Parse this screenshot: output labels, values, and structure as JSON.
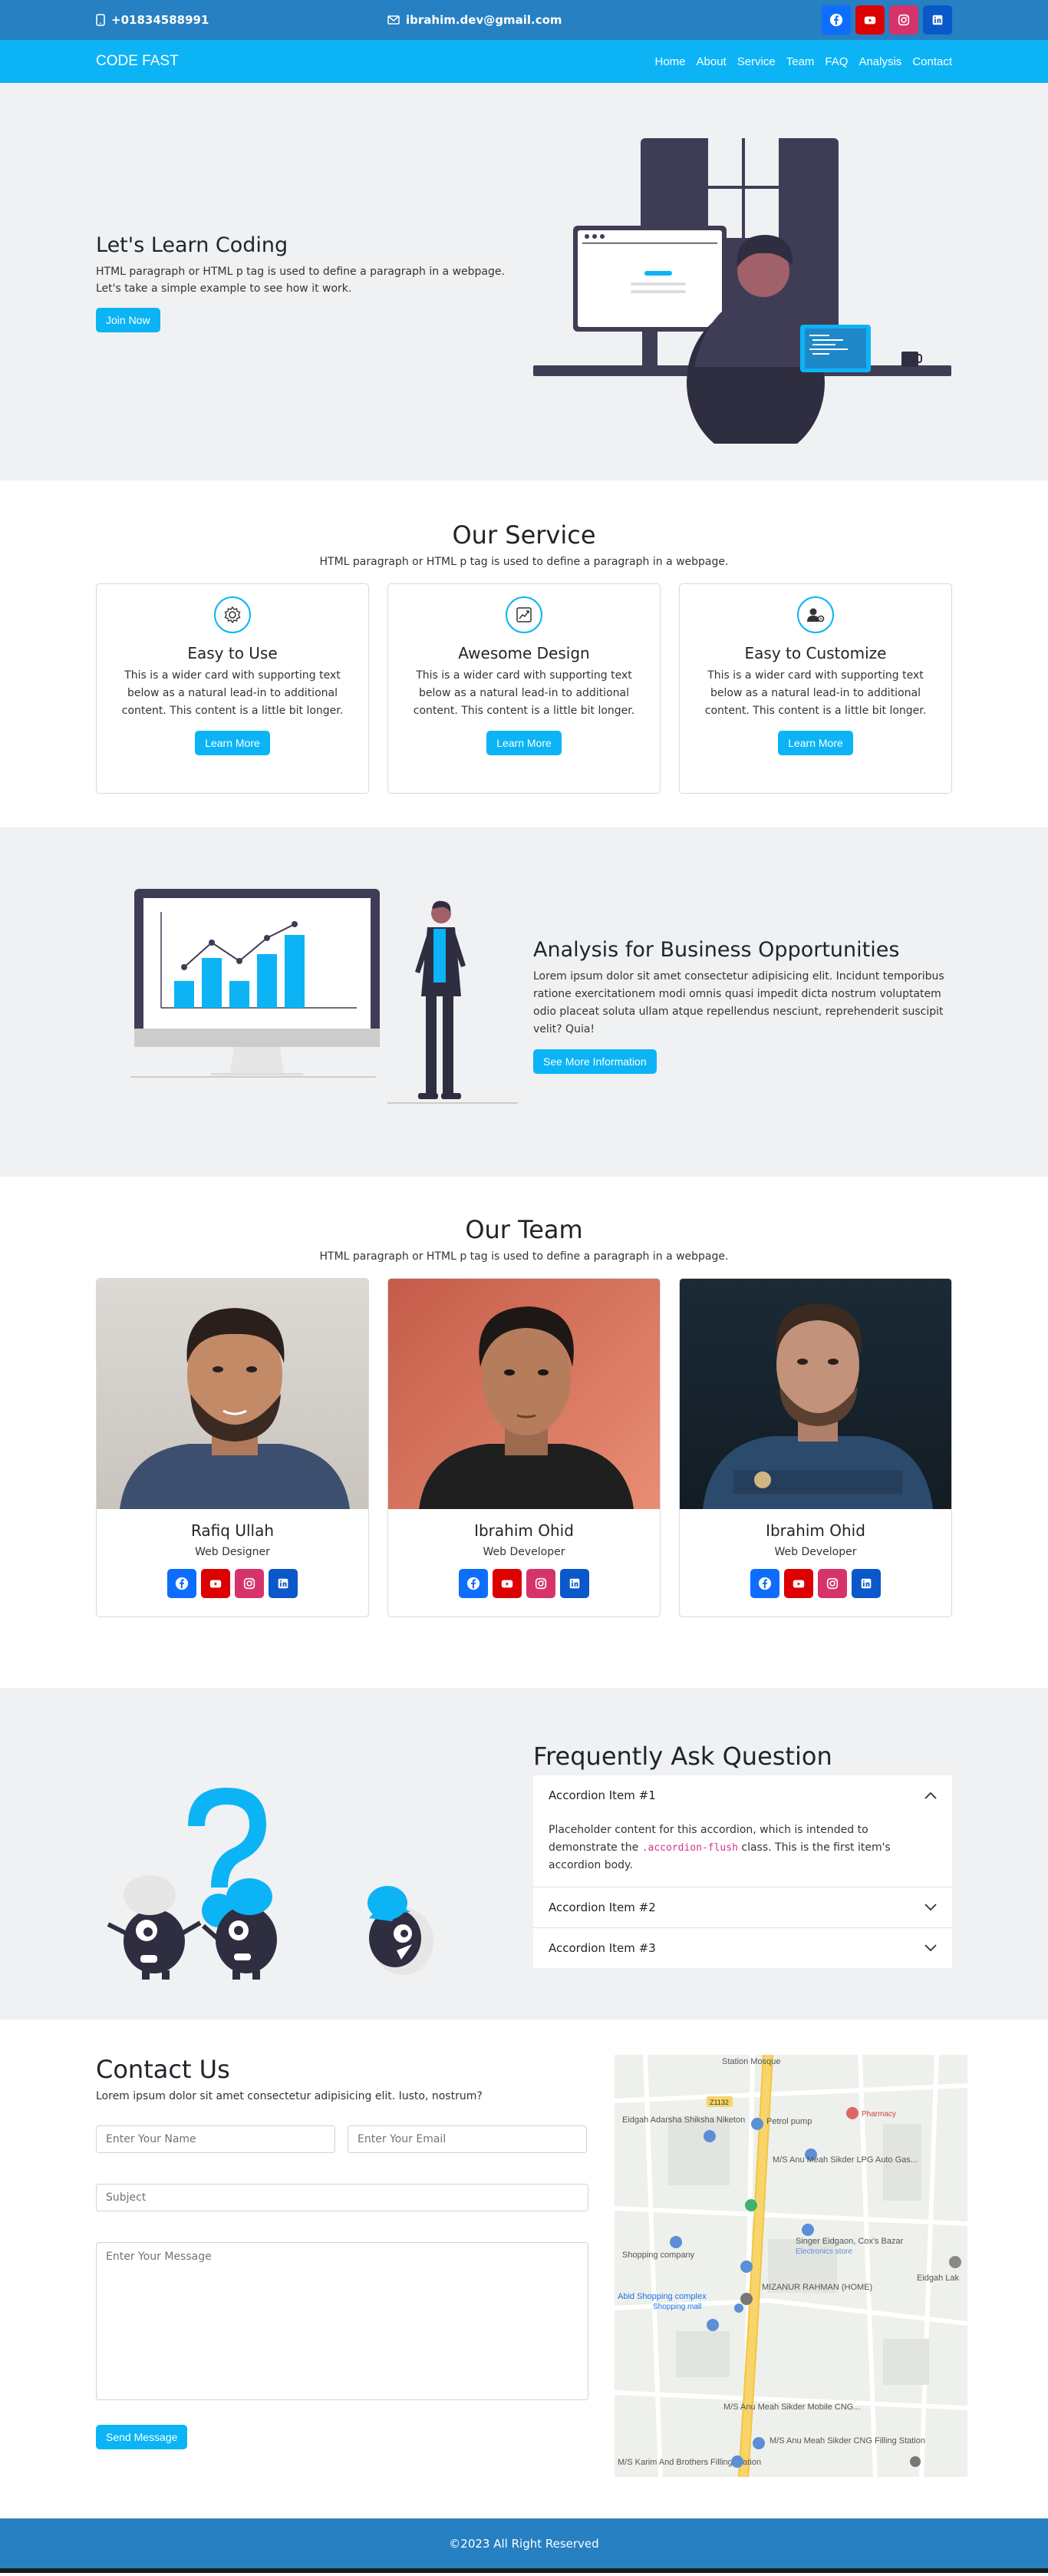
{
  "topbar": {
    "phone": "+01834588991",
    "email": "ibrahim.dev@gmail.com",
    "social": [
      "facebook-icon",
      "youtube-icon",
      "instagram-icon",
      "linkedin-icon"
    ]
  },
  "nav": {
    "brand": "CODE FAST",
    "links": [
      "Home",
      "About",
      "Service",
      "Team",
      "FAQ",
      "Analysis",
      "Contact"
    ]
  },
  "hero": {
    "title": "Let's Learn Coding",
    "text": "HTML paragraph or HTML p tag is used to define a paragraph in a webpage. Let's take a simple example to see how it work.",
    "button": "Join Now"
  },
  "service": {
    "title": "Our Service",
    "subtitle": "HTML paragraph or HTML p tag is used to define a paragraph in a webpage.",
    "cards": [
      {
        "icon": "gear-icon",
        "title": "Easy to Use",
        "text": "This is a wider card with supporting text below as a natural lead-in to additional content. This content is a little bit longer.",
        "button": "Learn More"
      },
      {
        "icon": "chart-line-icon",
        "title": "Awesome Design",
        "text": "This is a wider card with supporting text below as a natural lead-in to additional content. This content is a little bit longer.",
        "button": "Learn More"
      },
      {
        "icon": "user-gear-icon",
        "title": "Easy to Customize",
        "text": "This is a wider card with supporting text below as a natural lead-in to additional content. This content is a little bit longer.",
        "button": "Learn More"
      }
    ]
  },
  "analysis": {
    "title": "Analysis for Business Opportunities",
    "text": "Lorem ipsum dolor sit amet consectetur adipisicing elit. Incidunt temporibus ratione exercitationem modi omnis quasi impedit dicta nostrum voluptatem odio placeat soluta ullam atque repellendus nesciunt, reprehenderit suscipit velit? Quia!",
    "button": "See More Information"
  },
  "team": {
    "title": "Our Team",
    "subtitle": "HTML paragraph or HTML p tag is used to define a paragraph in a webpage.",
    "members": [
      {
        "name": "Rafiq Ullah",
        "role": "Web Designer"
      },
      {
        "name": "Ibrahim Ohid",
        "role": "Web Developer"
      },
      {
        "name": "Ibrahim Ohid",
        "role": "Web Developer"
      }
    ]
  },
  "faq": {
    "title": "Frequently Ask Question",
    "items": [
      {
        "label": "Accordion Item #1",
        "open": true,
        "body_before": "Placeholder content for this accordion, which is intended to demonstrate the ",
        "body_code": ".accordion-flush",
        "body_after": " class. This is the first item's accordion body."
      },
      {
        "label": "Accordion Item #2",
        "open": false
      },
      {
        "label": "Accordion Item #3",
        "open": false
      }
    ]
  },
  "contact": {
    "title": "Contact Us",
    "text": "Lorem ipsum dolor sit amet consectetur adipisicing elit. Iusto, nostrum?",
    "name_placeholder": "Enter Your Name",
    "email_placeholder": "Enter Your Email",
    "subject_placeholder": "Subject",
    "message_placeholder": "Enter Your Message",
    "button": "Send Message"
  },
  "map": {
    "labels": [
      "Eidgah Adarsha Shiksha Niketon",
      "Petrol pump",
      "M/S Anu Meah Sikder LPG Auto Gas...",
      "Singer Eidgaon, Cox's Bazar",
      "Electronics store",
      "Abid Shopping complex",
      "Shopping mall",
      "MIZANUR RAHMAN (HOME)",
      "M/S Anu Meah Sikder Mobile CNG...",
      "M/S Anu Meah Sikder CNG Filling Station",
      "M/S Karim And Brothers Filling Station",
      "Eidgah Lak",
      "Station Mosque",
      "Pharmacy",
      "Shopping company",
      "Z1132"
    ]
  },
  "footer": {
    "text": "©2023 All Right Reserved"
  }
}
